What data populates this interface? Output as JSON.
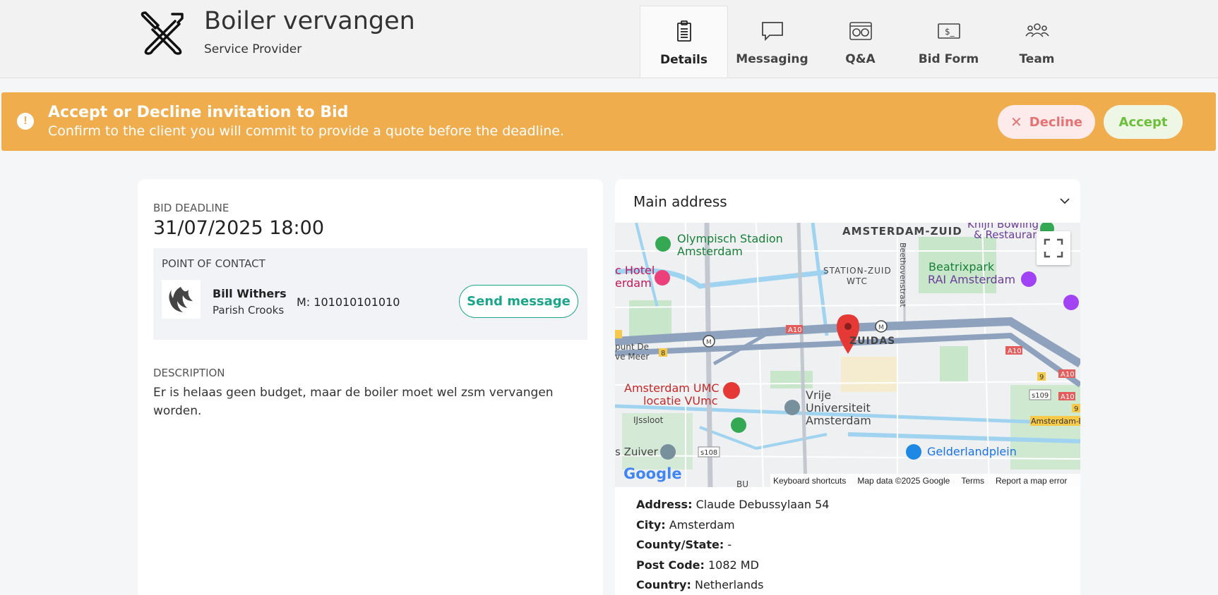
{
  "header": {
    "title": "Boiler vervangen",
    "subtitle": "Service Provider",
    "logo_icon": "tools-icon",
    "tabs": [
      {
        "label": "Details",
        "icon": "document-icon",
        "active": true
      },
      {
        "label": "Messaging",
        "icon": "chat-icon",
        "active": false
      },
      {
        "label": "Q&A",
        "icon": "qa-icon",
        "active": false
      },
      {
        "label": "Bid Form",
        "icon": "money-icon",
        "active": false
      },
      {
        "label": "Team",
        "icon": "team-icon",
        "active": false
      }
    ]
  },
  "banner": {
    "title": "Accept or Decline invitation to Bid",
    "text": "Confirm to the client you will commit to provide a quote before the deadline.",
    "decline_label": "Decline",
    "accept_label": "Accept",
    "color": "#f0ad4e"
  },
  "details": {
    "deadline_label": "BID DEADLINE",
    "deadline_value": "31/07/2025 18:00",
    "contact_label": "POINT OF CONTACT",
    "contact_name": "Bill Withers",
    "contact_company": "Parish Crooks",
    "contact_phone": "M: 101010101010",
    "send_message_label": "Send message",
    "description_label": "DESCRIPTION",
    "description_text": "Er is helaas geen budget, maar de boiler moet wel zsm vervangen worden."
  },
  "address": {
    "header": "Main address",
    "fields": {
      "address_label": "Address:",
      "address_value": "Claude Debussylaan 54",
      "city_label": "City:",
      "city_value": "Amsterdam",
      "county_label": "County/State:",
      "county_value": "-",
      "postcode_label": "Post Code:",
      "postcode_value": "1082 MD",
      "country_label": "Country:",
      "country_value": "Netherlands"
    },
    "map": {
      "labels": {
        "amsterdam_zuid": "AMSTERDAM-ZUID",
        "olympisch": "Olympisch Stadion",
        "olympisch2": "Amsterdam",
        "station_zuid": "STATION-ZUID",
        "wtc": "WTC",
        "beethoven": "Beethovenstraat",
        "beatrixpark": "Beatrixpark",
        "rai": "RAI Amsterdam",
        "hotel": "c Hotel",
        "hotel2": "erdam",
        "zuidas": "ZUIDAS",
        "umc": "Amsterdam UMC",
        "umc2": "locatie VUmc",
        "vu": "Vrije",
        "vu2": "Universiteit",
        "vu3": "Amsterdam",
        "ijssloot": "IJssloot",
        "zuiver": "s Zuiver",
        "gelderlandplein": "Gelderlandplein",
        "knijn": "Knijn Bowling",
        "knijn2": "& Restaurant",
        "punt": "punt De",
        "punt2": "ve Meer",
        "amsterdam_bu": "Amsterdam-Bu",
        "a10": "A10",
        "s108": "s108",
        "s109": "s109",
        "m": "M",
        "eight": "8",
        "nine": "9",
        "bu": "BU"
      },
      "google": "Google",
      "footer": [
        "Keyboard shortcuts",
        "Map data ©2025 Google",
        "Terms",
        "Report a map error"
      ]
    }
  }
}
